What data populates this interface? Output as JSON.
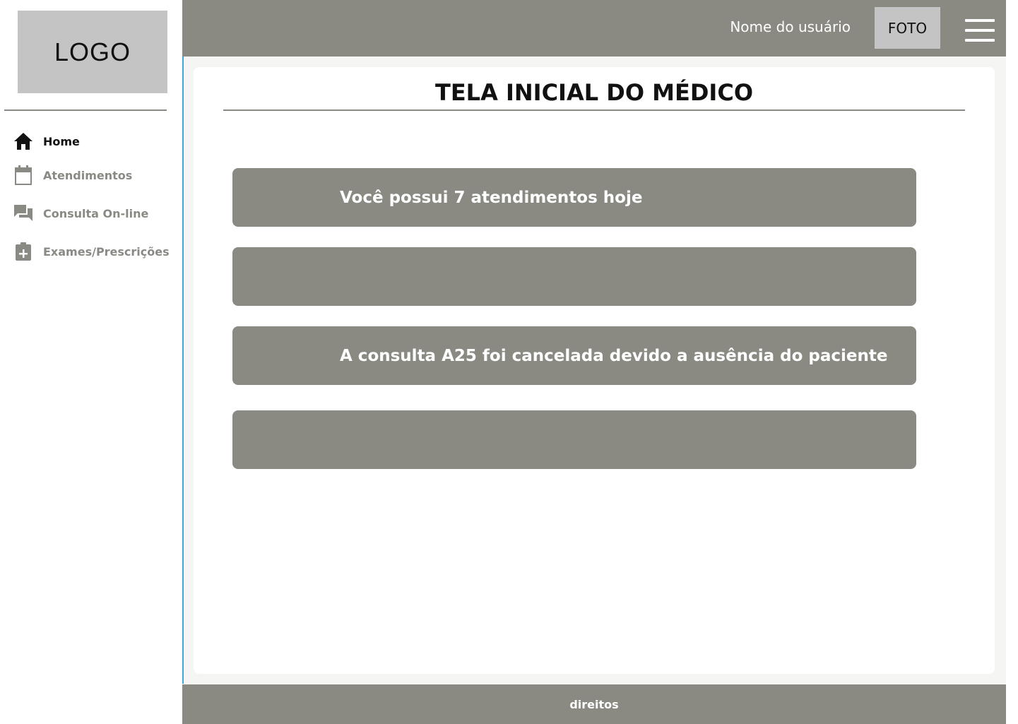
{
  "sidebar": {
    "logo_text": "LOGO",
    "items": [
      {
        "label": "Home",
        "icon": "home-icon",
        "active": true
      },
      {
        "label": "Atendimentos",
        "icon": "calendar-icon",
        "active": false
      },
      {
        "label": "Consulta On-line",
        "icon": "chat-icon",
        "active": false
      },
      {
        "label": "Exames/Prescrições",
        "icon": "clipboard-plus-icon",
        "active": false
      }
    ]
  },
  "header": {
    "username": "Nome do usuário",
    "photo_label": "FOTO",
    "menu_icon": "hamburger-menu-icon"
  },
  "main": {
    "title": "TELA INICIAL DO MÉDICO",
    "notices": [
      {
        "text": "Você possui 7 atendimentos hoje"
      },
      {
        "text": ""
      },
      {
        "text": "A consulta A25 foi cancelada devido a ausência do paciente"
      },
      {
        "text": ""
      }
    ]
  },
  "footer": {
    "text": "direitos"
  },
  "colors": {
    "bar_gray": "#8a8a82",
    "placeholder_gray": "#c4c4c4",
    "accent_line": "#3fa9d8",
    "inactive_nav": "#8a8a84"
  }
}
